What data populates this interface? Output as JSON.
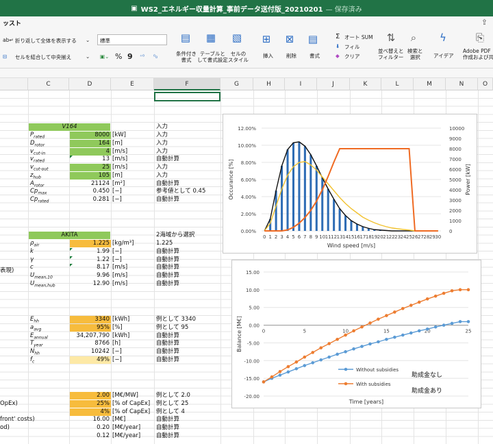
{
  "window": {
    "title": "WS2_エネルギー収量計算_事前データ送付版_20210201",
    "status": "— 保存済み"
  },
  "ribbon": {
    "tab": "ッスト",
    "wrap_text": "折り返して全体を表示する",
    "merge_center": "セルを結合して中央揃え",
    "number_format": "標準",
    "currency": "%",
    "comma": "9",
    "cond_format": "条件付き\n書式",
    "table_format": "テーブルと\nして書式設定",
    "cell_style": "セルの\nスタイル",
    "insert": "挿入",
    "delete": "削除",
    "format": "書式",
    "autosum": "オート SUM",
    "fill": "フィル",
    "clear": "クリア",
    "sort_filter": "並べ替えと\nフィルター",
    "find_select": "検索と\n選択",
    "ideas": "アイデア",
    "adobe": "Adobe PDF\n作成および共"
  },
  "columns": [
    "C",
    "D",
    "E",
    "F",
    "G",
    "H",
    "I",
    "J",
    "K",
    "L",
    "M",
    "N",
    "O"
  ],
  "sheet": {
    "v164": "V164",
    "input_hdr": "入力",
    "rows1": [
      {
        "label": "P",
        "sub": "rated",
        "val": "8000",
        "unit": "[kW]",
        "note": "入力"
      },
      {
        "label": "D",
        "sub": "rotor",
        "val": "164",
        "unit": "[m]",
        "note": "入力"
      },
      {
        "label": "v",
        "sub": "cut-in",
        "val": "4",
        "unit": "[m/s]",
        "note": "入力"
      },
      {
        "label": "v",
        "sub": "rated",
        "val": "13",
        "unit": "[m/s]",
        "note": "自動計算"
      },
      {
        "label": "v",
        "sub": "cut-out",
        "val": "25",
        "unit": "[m/s]",
        "note": "入力"
      },
      {
        "label": "z",
        "sub": "hub",
        "val": "105",
        "unit": "[m]",
        "note": "入力"
      },
      {
        "label": "A",
        "sub": "rotor",
        "val": "21124",
        "unit": "[m²]",
        "note": "自動計算"
      },
      {
        "label": "Cp",
        "sub": "max",
        "val": "0.450",
        "unit": "[−]",
        "note": "参考値として  0.45"
      },
      {
        "label": "Cp",
        "sub": "rated",
        "val": "0.281",
        "unit": "[−]",
        "note": "自動計算"
      }
    ],
    "akita": "AKITA",
    "area_sel": "2海域から選択",
    "rows2": [
      {
        "label": "ρ",
        "sub": "air",
        "val": "1.225",
        "unit": "[kg/m³]",
        "note": "1.225"
      },
      {
        "label": "k",
        "sub": "",
        "val": "1.99",
        "unit": "[−]",
        "note": "自動計算"
      },
      {
        "label": "γ",
        "sub": "",
        "val": "1.22",
        "unit": "[−]",
        "note": "自動計算"
      },
      {
        "label": "c",
        "sub": "",
        "val": "8.17",
        "unit": "[m/s]",
        "note": "自動計算"
      },
      {
        "label": "U",
        "sub": "mean,10",
        "val": "9.96",
        "unit": "[m/s]",
        "note": "自動計算"
      },
      {
        "label": "U",
        "sub": "mean,hub",
        "val": "12.90",
        "unit": "[m/s]",
        "note": "自動計算"
      }
    ],
    "left_cut": "表現)",
    "rows3": [
      {
        "label": "E",
        "sub": "hh",
        "val": "3340",
        "unit": "[kWh]",
        "note": "例として  3340"
      },
      {
        "label": "a",
        "sub": "avg",
        "val": "95%",
        "unit": "[%]",
        "note": "例として  95"
      },
      {
        "label": "E",
        "sub": "annual",
        "val": "34,207,790",
        "unit": "[kWh]",
        "note": "自動計算"
      },
      {
        "label": "T",
        "sub": "year",
        "val": "8766",
        "unit": "[h]",
        "note": "自動計算"
      },
      {
        "label": "N",
        "sub": "hh",
        "val": "10242",
        "unit": "[−]",
        "note": "自動計算"
      },
      {
        "label": "f",
        "sub": "c",
        "val": "49%",
        "unit": "[−]",
        "note": "自動計算"
      }
    ],
    "rows4": [
      {
        "left": "",
        "val": "2.00",
        "unit": "[M€/MW]",
        "note": "例として  2.0"
      },
      {
        "left": "OpEx)",
        "val": "25%",
        "unit": "[% of CapEx]",
        "note": "例として  25"
      },
      {
        "left": "",
        "val": "4%",
        "unit": "[% of CapEx]",
        "note": "例として  4"
      },
      {
        "left": "front' costs)",
        "val": "16.00",
        "unit": "[M€]",
        "note": "自動計算"
      },
      {
        "left": "od)",
        "val": "0.20",
        "unit": "[M€/year]",
        "note": "自動計算"
      },
      {
        "left": "",
        "val": "0.12",
        "unit": "[M€/year]",
        "note": "自動計算"
      }
    ]
  },
  "chart_data": [
    {
      "type": "bar",
      "xlabel": "Wind speed [m/s]",
      "ylabel": "Occurance [%]",
      "y2label": "Power [kW]",
      "ylim": [
        0,
        12
      ],
      "y2lim": [
        0,
        10000
      ],
      "categories": [
        0,
        1,
        2,
        3,
        4,
        5,
        6,
        7,
        8,
        9,
        10,
        11,
        12,
        13,
        14,
        15,
        16,
        17,
        18,
        19,
        20,
        21,
        22,
        23,
        24,
        25,
        26,
        27,
        28,
        29,
        30
      ],
      "yticks": [
        "0.00%",
        "2.00%",
        "4.00%",
        "6.00%",
        "8.00%",
        "10.00%",
        "12.00%"
      ],
      "y2ticks": [
        "0",
        "1000",
        "2000",
        "3000",
        "4000",
        "5000",
        "6000",
        "7000",
        "8000",
        "9000",
        "10000"
      ],
      "series": [
        {
          "name": "",
          "style": "bars",
          "color": "#2f6db5",
          "values": [
            0,
            1.4,
            4.7,
            7.6,
            9.5,
            10.3,
            10.4,
            9.9,
            8.9,
            7.6,
            6.2,
            4.9,
            3.7,
            2.6,
            1.8,
            1.2,
            0.8,
            0.5,
            0.3,
            0.15,
            0.1,
            0.05,
            0,
            0,
            0,
            0,
            0,
            0,
            0,
            0,
            0
          ]
        },
        {
          "name": "",
          "style": "line",
          "color": "#111111",
          "values": [
            0,
            1.4,
            4.7,
            7.6,
            9.5,
            10.3,
            10.4,
            9.9,
            8.9,
            7.6,
            6.2,
            4.9,
            3.7,
            2.6,
            1.8,
            1.2,
            0.8,
            0.5,
            0.3,
            0.15,
            0.1,
            0.05,
            0,
            0,
            0,
            0,
            0,
            0,
            0,
            0,
            0
          ]
        },
        {
          "name": "",
          "style": "line",
          "color": "#f2c230",
          "values": [
            0,
            0.9,
            2.9,
            4.9,
            6.5,
            7.5,
            8.0,
            8.1,
            7.7,
            7.1,
            6.3,
            5.5,
            4.7,
            3.9,
            3.2,
            2.6,
            2.1,
            1.6,
            1.25,
            0.95,
            0.7,
            0.5,
            0.35,
            0.25,
            0.17,
            0.1,
            0,
            0,
            0,
            0,
            0
          ]
        },
        {
          "name": "",
          "style": "line",
          "axis": "y2",
          "color": "#ef6a22",
          "values": [
            0,
            0,
            0,
            0,
            100,
            350,
            750,
            1300,
            2000,
            2900,
            4000,
            5300,
            6700,
            8000,
            8000,
            8000,
            8000,
            8000,
            8000,
            8000,
            8000,
            8000,
            8000,
            8000,
            8000,
            8000,
            0,
            0,
            0,
            0,
            0
          ]
        }
      ]
    },
    {
      "type": "line",
      "xlabel": "Time [years]",
      "ylabel": "Balance [M€]",
      "ylim": [
        -20,
        15
      ],
      "xlim": [
        0,
        25
      ],
      "xticks": [
        "0",
        "5",
        "10",
        "15",
        "20",
        "25"
      ],
      "yticks": [
        "-20.00",
        "-15.00",
        "-10.00",
        "-5.00",
        "0.00",
        "5.00",
        "10.00",
        "15.00"
      ],
      "x": [
        0,
        1,
        2,
        3,
        4,
        5,
        6,
        7,
        8,
        9,
        10,
        11,
        12,
        13,
        14,
        15,
        16,
        17,
        18,
        19,
        20,
        21,
        22,
        23,
        24,
        25
      ],
      "series": [
        {
          "name": "Without subsidies",
          "color": "#5b9bd5",
          "values": [
            -16.0,
            -15.0,
            -14.1,
            -13.2,
            -12.3,
            -11.4,
            -10.6,
            -9.8,
            -9.0,
            -8.2,
            -7.5,
            -6.7,
            -6.0,
            -5.3,
            -4.7,
            -4.0,
            -3.4,
            -2.8,
            -2.2,
            -1.6,
            -1.1,
            -0.5,
            0.0,
            0.5,
            1.0,
            1.0
          ]
        },
        {
          "name": "With subsidies",
          "color": "#ed7d31",
          "values": [
            -16.0,
            -14.6,
            -13.1,
            -11.7,
            -10.4,
            -9.0,
            -7.7,
            -6.4,
            -5.2,
            -4.0,
            -2.8,
            -1.6,
            -0.5,
            0.6,
            1.7,
            2.7,
            3.7,
            4.7,
            5.6,
            6.5,
            7.4,
            8.2,
            9.0,
            9.7,
            10.0,
            10.0
          ]
        }
      ],
      "annotations": [
        "助成金なし",
        "助成金あり"
      ]
    }
  ]
}
